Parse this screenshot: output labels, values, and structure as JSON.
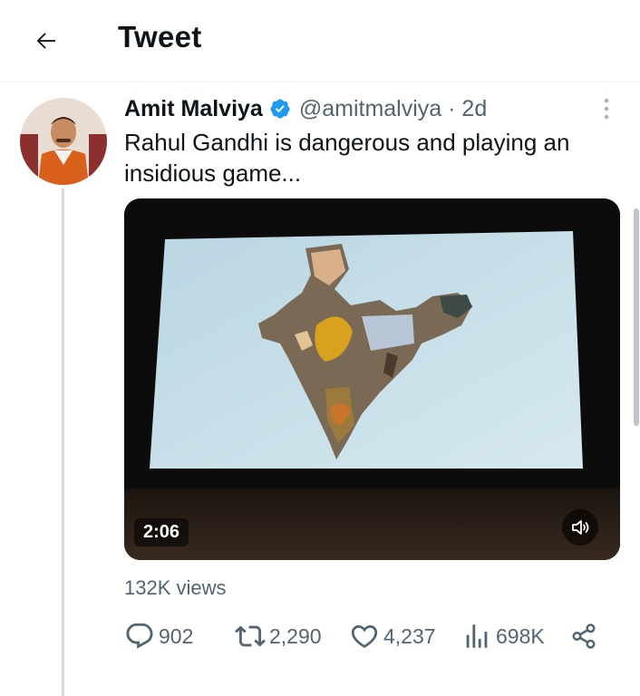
{
  "header": {
    "title": "Tweet"
  },
  "tweet": {
    "author_name": "Amit Malviya",
    "handle_time": "@amitmalviya · 2d",
    "text": "Rahul Gandhi is dangerous and playing an insidious game...",
    "video": {
      "duration": "2:06"
    },
    "views": "132K views",
    "stats": {
      "replies": "902",
      "retweets": "2,290",
      "likes": "4,237",
      "views": "698K"
    }
  },
  "colors": {
    "text": "#0f1419",
    "secondary": "#536471",
    "verified": "#1d9bf0",
    "divider": "#eff3f4"
  }
}
